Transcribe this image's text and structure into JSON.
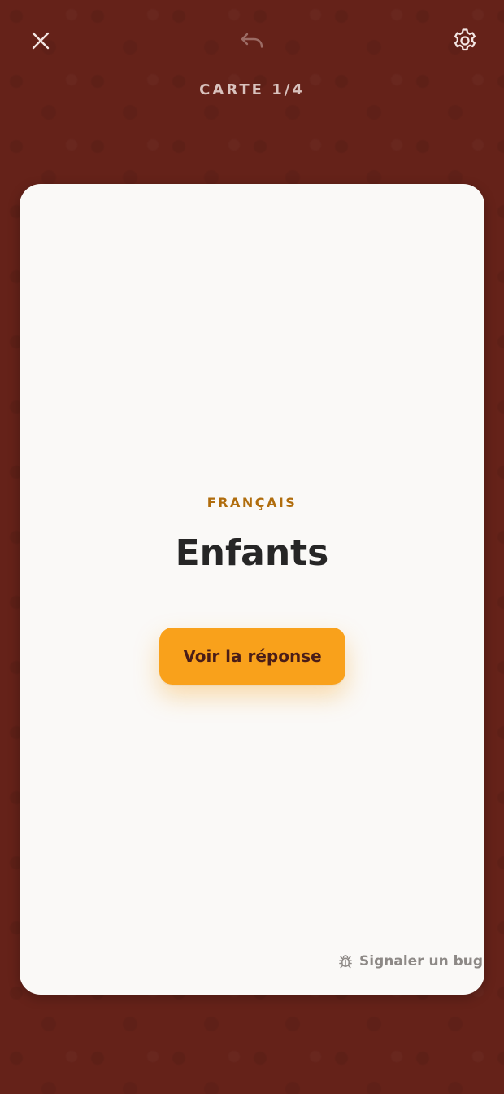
{
  "header": {
    "close_icon": "close-icon",
    "undo_icon": "undo-icon",
    "settings_icon": "gear-icon",
    "counter": "CARTE 1/4"
  },
  "card": {
    "language": "FRANÇAIS",
    "word": "Enfants",
    "reveal_button_label": "Voir la réponse",
    "bug_icon": "bug-icon",
    "bug_report_label": "Signaler un bug"
  },
  "colors": {
    "background": "#652219",
    "card": "#faf9f7",
    "accent": "#f9a11b",
    "language_label": "#b06d0d",
    "counter_text": "#d9c2bd"
  }
}
